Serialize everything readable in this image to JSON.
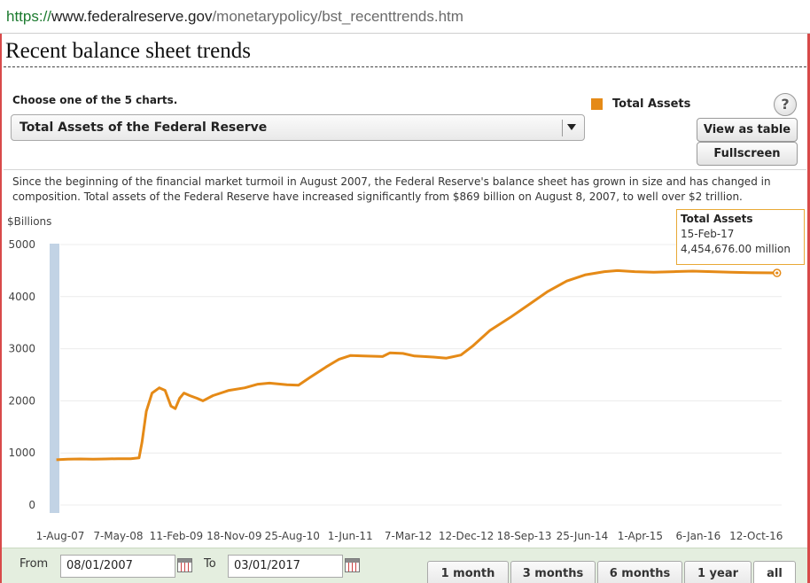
{
  "browser": {
    "url_protocol": "https://",
    "url_host": "www.federalreserve.gov",
    "url_path": "/monetarypolicy/bst_recenttrends.htm"
  },
  "page": {
    "title": "Recent balance sheet trends",
    "choose_label": "Choose one of the 5 charts.",
    "selected_chart": "Total Assets of the Federal Reserve",
    "legend_label": "Total Assets",
    "help_label": "?",
    "view_table_button": "View as table",
    "fullscreen_button": "Fullscreen",
    "description": "Since the beginning of the financial market turmoil in August 2007, the Federal Reserve's balance sheet has grown in size and has changed in composition. Total assets of the Federal Reserve have increased significantly from $869 billion on August 8, 2007, to well over $2 trillion."
  },
  "colors": {
    "series": "#e58a17",
    "nav_band": "#c2d3e5",
    "gridline": "#ececec"
  },
  "tooltip": {
    "title": "Total Assets",
    "date": "15-Feb-17",
    "value": "4,454,676.00 million"
  },
  "footer": {
    "from_label": "From",
    "from_value": "08/01/2007",
    "to_label": "To",
    "to_value": "03/01/2017",
    "ranges": [
      {
        "label": "1 month",
        "active": false
      },
      {
        "label": "3 months",
        "active": false
      },
      {
        "label": "6 months",
        "active": false
      },
      {
        "label": "1 year",
        "active": false
      },
      {
        "label": "all",
        "active": true
      }
    ]
  },
  "chart_data": {
    "type": "line",
    "ylabel": "$Billions",
    "ylim": [
      0,
      5000
    ],
    "yticks": [
      0,
      1000,
      2000,
      3000,
      4000,
      5000
    ],
    "xlim": [
      "2007-08-01",
      "2017-03-01"
    ],
    "x_tick_labels": [
      {
        "date": "2007-08-01",
        "label": "1-Aug-07"
      },
      {
        "date": "2008-05-07",
        "label": "7-May-08"
      },
      {
        "date": "2009-02-11",
        "label": "11-Feb-09"
      },
      {
        "date": "2009-11-18",
        "label": "18-Nov-09"
      },
      {
        "date": "2010-08-25",
        "label": "25-Aug-10"
      },
      {
        "date": "2011-06-01",
        "label": "1-Jun-11"
      },
      {
        "date": "2012-03-07",
        "label": "7-Mar-12"
      },
      {
        "date": "2012-12-12",
        "label": "12-Dec-12"
      },
      {
        "date": "2013-09-18",
        "label": "18-Sep-13"
      },
      {
        "date": "2014-06-25",
        "label": "25-Jun-14"
      },
      {
        "date": "2015-04-01",
        "label": "1-Apr-15"
      },
      {
        "date": "2016-01-06",
        "label": "6-Jan-16"
      },
      {
        "date": "2016-10-12",
        "label": "12-Oct-16"
      }
    ],
    "grid": true,
    "legend": "top-right",
    "series": [
      {
        "name": "Total Assets",
        "points": [
          [
            "2007-08-08",
            869
          ],
          [
            "2007-10-01",
            880
          ],
          [
            "2007-12-01",
            885
          ],
          [
            "2008-02-01",
            880
          ],
          [
            "2008-04-01",
            885
          ],
          [
            "2008-06-01",
            890
          ],
          [
            "2008-08-01",
            890
          ],
          [
            "2008-09-10",
            905
          ],
          [
            "2008-09-24",
            1200
          ],
          [
            "2008-10-15",
            1800
          ],
          [
            "2008-11-12",
            2150
          ],
          [
            "2008-12-17",
            2250
          ],
          [
            "2009-01-14",
            2200
          ],
          [
            "2009-02-11",
            1900
          ],
          [
            "2009-03-04",
            1850
          ],
          [
            "2009-03-25",
            2050
          ],
          [
            "2009-04-15",
            2150
          ],
          [
            "2009-05-13",
            2100
          ],
          [
            "2009-06-17",
            2050
          ],
          [
            "2009-07-15",
            2000
          ],
          [
            "2009-09-02",
            2100
          ],
          [
            "2009-11-18",
            2200
          ],
          [
            "2010-02-03",
            2250
          ],
          [
            "2010-04-07",
            2320
          ],
          [
            "2010-06-02",
            2340
          ],
          [
            "2010-08-25",
            2310
          ],
          [
            "2010-10-20",
            2300
          ],
          [
            "2010-12-15",
            2450
          ],
          [
            "2011-03-02",
            2650
          ],
          [
            "2011-05-04",
            2800
          ],
          [
            "2011-06-29",
            2870
          ],
          [
            "2011-08-31",
            2860
          ],
          [
            "2011-11-30",
            2850
          ],
          [
            "2012-01-04",
            2920
          ],
          [
            "2012-03-07",
            2910
          ],
          [
            "2012-05-02",
            2860
          ],
          [
            "2012-08-01",
            2840
          ],
          [
            "2012-10-03",
            2820
          ],
          [
            "2012-12-12",
            2880
          ],
          [
            "2013-02-06",
            3050
          ],
          [
            "2013-05-01",
            3350
          ],
          [
            "2013-08-07",
            3600
          ],
          [
            "2013-11-06",
            3850
          ],
          [
            "2014-02-05",
            4100
          ],
          [
            "2014-05-07",
            4300
          ],
          [
            "2014-08-06",
            4420
          ],
          [
            "2014-11-05",
            4480
          ],
          [
            "2015-01-07",
            4500
          ],
          [
            "2015-04-01",
            4480
          ],
          [
            "2015-07-01",
            4470
          ],
          [
            "2015-10-07",
            4480
          ],
          [
            "2016-01-06",
            4490
          ],
          [
            "2016-04-06",
            4480
          ],
          [
            "2016-07-06",
            4470
          ],
          [
            "2016-10-12",
            4460
          ],
          [
            "2017-02-15",
            4455
          ]
        ]
      }
    ]
  }
}
